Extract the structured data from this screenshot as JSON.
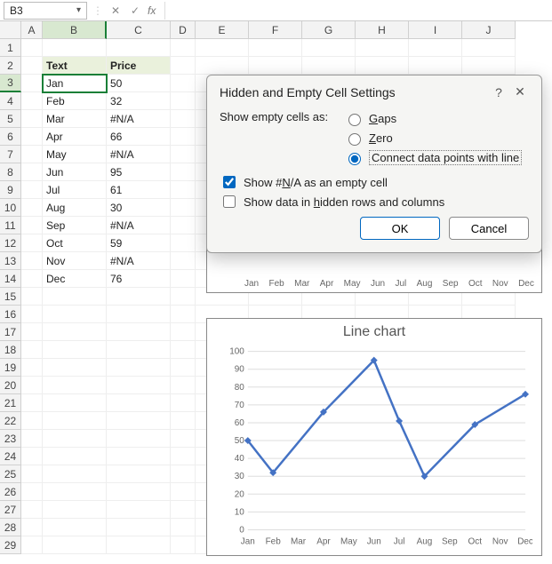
{
  "formula_bar": {
    "active_cell": "B3",
    "fx_label": "fx"
  },
  "columns": [
    "A",
    "B",
    "C",
    "D",
    "E",
    "F",
    "G",
    "H",
    "I",
    "J"
  ],
  "rows": [
    "1",
    "2",
    "3",
    "4",
    "5",
    "6",
    "7",
    "8",
    "9",
    "10",
    "11",
    "12",
    "13",
    "14",
    "15",
    "16",
    "17",
    "18",
    "19",
    "20",
    "21",
    "22",
    "23",
    "24",
    "25",
    "26",
    "27",
    "28",
    "29"
  ],
  "table": {
    "header": {
      "text": "Text",
      "price": "Price"
    },
    "rows": [
      {
        "text": "Jan",
        "price": "50"
      },
      {
        "text": "Feb",
        "price": "32"
      },
      {
        "text": "Mar",
        "price": "#N/A"
      },
      {
        "text": "Apr",
        "price": "66"
      },
      {
        "text": "May",
        "price": "#N/A"
      },
      {
        "text": "Jun",
        "price": "95"
      },
      {
        "text": "Jul",
        "price": "61"
      },
      {
        "text": "Aug",
        "price": "30"
      },
      {
        "text": "Sep",
        "price": "#N/A"
      },
      {
        "text": "Oct",
        "price": "59"
      },
      {
        "text": "Nov",
        "price": "#N/A"
      },
      {
        "text": "Dec",
        "price": "76"
      }
    ]
  },
  "dialog": {
    "title": "Hidden and Empty Cell Settings",
    "show_label": "Show empty cells as:",
    "opt_gaps": "Gaps",
    "opt_zero": "Zero",
    "opt_connect": "Connect data points with line",
    "selected_option": "connect",
    "chk_na": "Show #N/A as an empty cell",
    "chk_na_checked": true,
    "chk_hidden": "Show data in hidden rows and columns",
    "chk_hidden_checked": false,
    "ok": "OK",
    "cancel": "Cancel",
    "help": "?",
    "close": "✕"
  },
  "bg_chart_months": [
    "Jan",
    "Feb",
    "Mar",
    "Apr",
    "May",
    "Jun",
    "Jul",
    "Aug",
    "Sep",
    "Oct",
    "Nov",
    "Dec"
  ],
  "chart_data": {
    "type": "line",
    "title": "Line chart",
    "xlabel": "",
    "ylabel": "",
    "ylim": [
      0,
      100
    ],
    "yticks": [
      0,
      10,
      20,
      30,
      40,
      50,
      60,
      70,
      80,
      90,
      100
    ],
    "categories": [
      "Jan",
      "Feb",
      "Mar",
      "Apr",
      "May",
      "Jun",
      "Jul",
      "Aug",
      "Sep",
      "Oct",
      "Nov",
      "Dec"
    ],
    "values": [
      50,
      32,
      null,
      66,
      null,
      95,
      61,
      30,
      null,
      59,
      null,
      76
    ],
    "connect_na": true
  }
}
